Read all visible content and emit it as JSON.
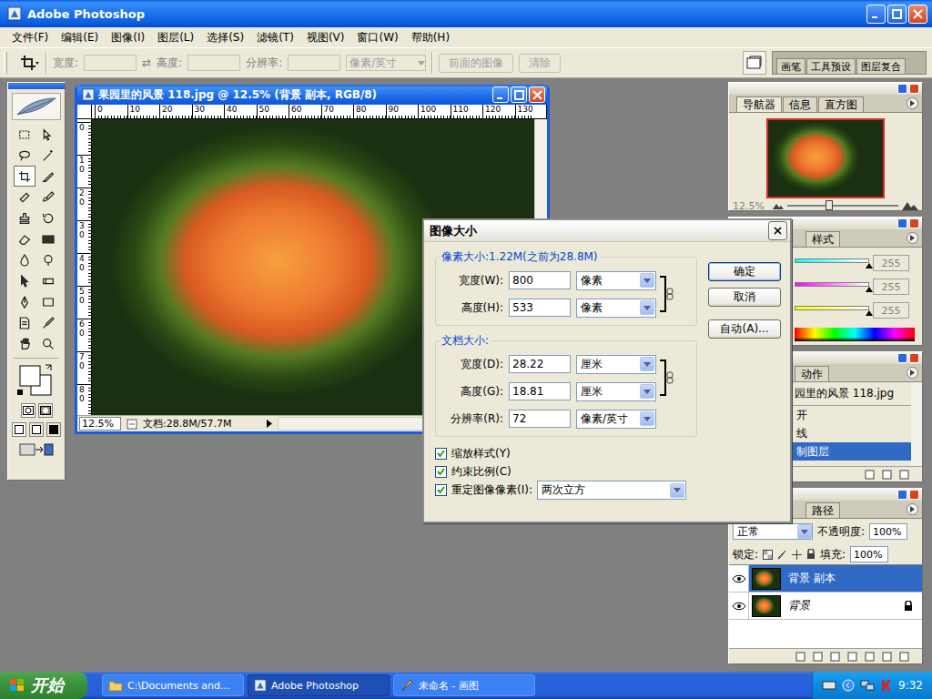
{
  "app": {
    "title": "Adobe Photoshop"
  },
  "menu": [
    {
      "label": "文件(F)"
    },
    {
      "label": "编辑(E)"
    },
    {
      "label": "图像(I)"
    },
    {
      "label": "图层(L)"
    },
    {
      "label": "选择(S)"
    },
    {
      "label": "滤镜(T)"
    },
    {
      "label": "视图(V)"
    },
    {
      "label": "窗口(W)"
    },
    {
      "label": "帮助(H)"
    }
  ],
  "options_bar": {
    "fields": [
      {
        "label": "宽度:",
        "value": ""
      },
      {
        "label": "高度:",
        "value": ""
      },
      {
        "label": "分辨率:",
        "value": ""
      }
    ],
    "swap": "⇄",
    "unit": "像素/英寸",
    "buttons": [
      {
        "label": "前面的图像",
        "disabled": true
      },
      {
        "label": "清除",
        "disabled": true
      }
    ],
    "palette_well": [
      "画笔",
      "工具预设",
      "图层复合"
    ]
  },
  "toolbox": {
    "tools": [
      {
        "selected": false
      },
      {
        "selected": false
      },
      {
        "selected": false
      },
      {
        "selected": false
      },
      {
        "selected": true
      },
      {
        "selected": false
      },
      {
        "selected": false
      },
      {
        "selected": false
      },
      {
        "selected": false
      },
      {
        "selected": false
      },
      {
        "selected": false
      },
      {
        "selected": false
      },
      {
        "selected": false
      },
      {
        "selected": false
      },
      {
        "selected": false
      },
      {
        "selected": false
      },
      {
        "selected": false
      },
      {
        "selected": false
      },
      {
        "selected": false
      },
      {
        "selected": false
      },
      {
        "selected": false
      },
      {
        "selected": false
      }
    ]
  },
  "document": {
    "title": "果园里的风景 118.jpg @ 12.5% (背景 副本, RGB/8)",
    "ruler_h": [
      "0",
      "10",
      "20",
      "30",
      "40",
      "50",
      "60",
      "70",
      "80",
      "90",
      "100",
      "110",
      "120",
      "130"
    ],
    "ruler_v": [
      "0",
      "10",
      "20",
      "30",
      "40",
      "50",
      "60",
      "70",
      "80"
    ],
    "zoom": "12.5%",
    "info": "文档:28.8M/57.7M"
  },
  "dialog": {
    "title": "图像大小",
    "pixel_group": "像素大小:1.22M(之前为28.8M)",
    "pixel_fields": [
      {
        "label": "宽度(W):",
        "value": "800",
        "unit": "像素",
        "linked": true
      },
      {
        "label": "高度(H):",
        "value": "533",
        "unit": "像素",
        "linked": true
      }
    ],
    "doc_group": "文档大小:",
    "doc_fields": [
      {
        "label": "宽度(D):",
        "value": "28.22",
        "unit": "厘米",
        "linked": true
      },
      {
        "label": "高度(G):",
        "value": "18.81",
        "unit": "厘米",
        "linked": true
      },
      {
        "label": "分辨率(R):",
        "value": "72",
        "unit": "像素/英寸",
        "linked": false
      }
    ],
    "checks": [
      {
        "label": "缩放样式(Y)",
        "checked": true
      },
      {
        "label": "约束比例(C)",
        "checked": true
      }
    ],
    "resample": {
      "label": "重定图像像素(I):",
      "checked": true,
      "value": "两次立方"
    },
    "buttons": [
      {
        "label": "确定",
        "default": true
      },
      {
        "label": "取消",
        "default": false
      },
      {
        "label": "自动(A)...",
        "default": false
      }
    ]
  },
  "navigator": {
    "tabs": [
      {
        "label": "导航器",
        "selected": true
      },
      {
        "label": "信息",
        "selected": false
      },
      {
        "label": "直方图",
        "selected": false
      }
    ],
    "zoom": "12.5%",
    "level": 0.38
  },
  "color": {
    "tabs": [
      {
        "label": "样式",
        "selected": false
      }
    ],
    "channels": [
      {
        "value": "255",
        "level": 1,
        "color": "#00ffff"
      },
      {
        "value": "255",
        "level": 1,
        "color": "#ff00ff"
      },
      {
        "value": "255",
        "level": 1,
        "color": "#ffff00"
      }
    ]
  },
  "history": {
    "tabs": [
      {
        "label": "动作",
        "selected": false
      }
    ],
    "snapshot": "园里的风景 118.jpg",
    "items": [
      {
        "label": "开",
        "selected": false
      },
      {
        "label": "线",
        "selected": false
      },
      {
        "label": "制图层",
        "selected": true
      }
    ]
  },
  "layers": {
    "tabs": [
      {
        "label": "路径",
        "selected": false
      }
    ],
    "blend": "正常",
    "opacity_label": "不透明度:",
    "opacity": "100%",
    "lock_label": "锁定:",
    "fill_label": "填充:",
    "fill": "100%",
    "items": [
      {
        "name": "背景 副本",
        "selected": true,
        "visible": true,
        "locked": false,
        "italic": false
      },
      {
        "name": "背景",
        "selected": false,
        "visible": true,
        "locked": true,
        "italic": true
      }
    ]
  },
  "taskbar": {
    "start": "开始",
    "tasks": [
      {
        "label": "C:\\Documents and...",
        "selected": false
      },
      {
        "label": "Adobe Photoshop",
        "selected": true
      },
      {
        "label": "未命名 - 画图",
        "selected": false
      }
    ],
    "clock": "9:32"
  }
}
